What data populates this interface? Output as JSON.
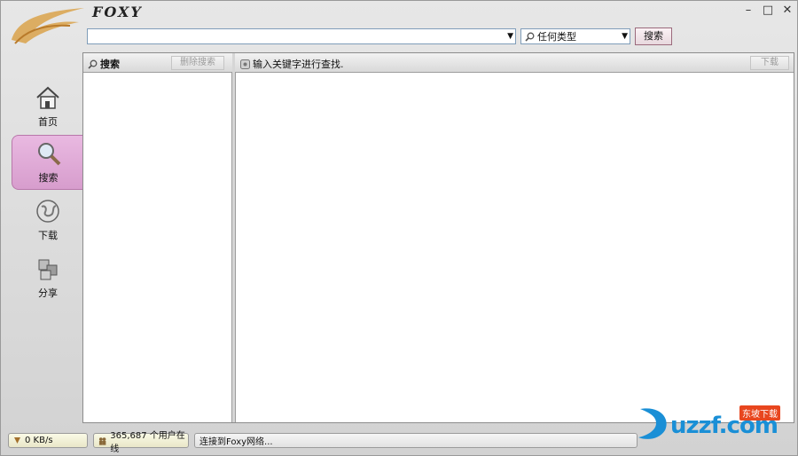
{
  "app": {
    "logo_text": "FOXY"
  },
  "window_controls": {
    "minimize": "–",
    "maximize": "□",
    "close": "✕"
  },
  "search": {
    "query": "",
    "placeholder": "",
    "type_selected": "任何类型",
    "button_label": "搜索"
  },
  "sidebar": {
    "items": [
      {
        "label": "首页",
        "icon": "home-icon"
      },
      {
        "label": "搜索",
        "icon": "search-icon",
        "active": true
      },
      {
        "label": "下载",
        "icon": "globe-icon"
      },
      {
        "label": "分享",
        "icon": "share-icon"
      }
    ]
  },
  "panel": {
    "left_title": "搜索",
    "delete_button": "删除搜索",
    "right_message": "输入关键字进行查找.",
    "download_button": "下载"
  },
  "status": {
    "speed": "0 KB/s",
    "users": "365,687 个用户在线",
    "connection": "连接到Foxy网络..."
  },
  "watermark": {
    "text": "uzzf.com",
    "badge": "东坡下载"
  }
}
